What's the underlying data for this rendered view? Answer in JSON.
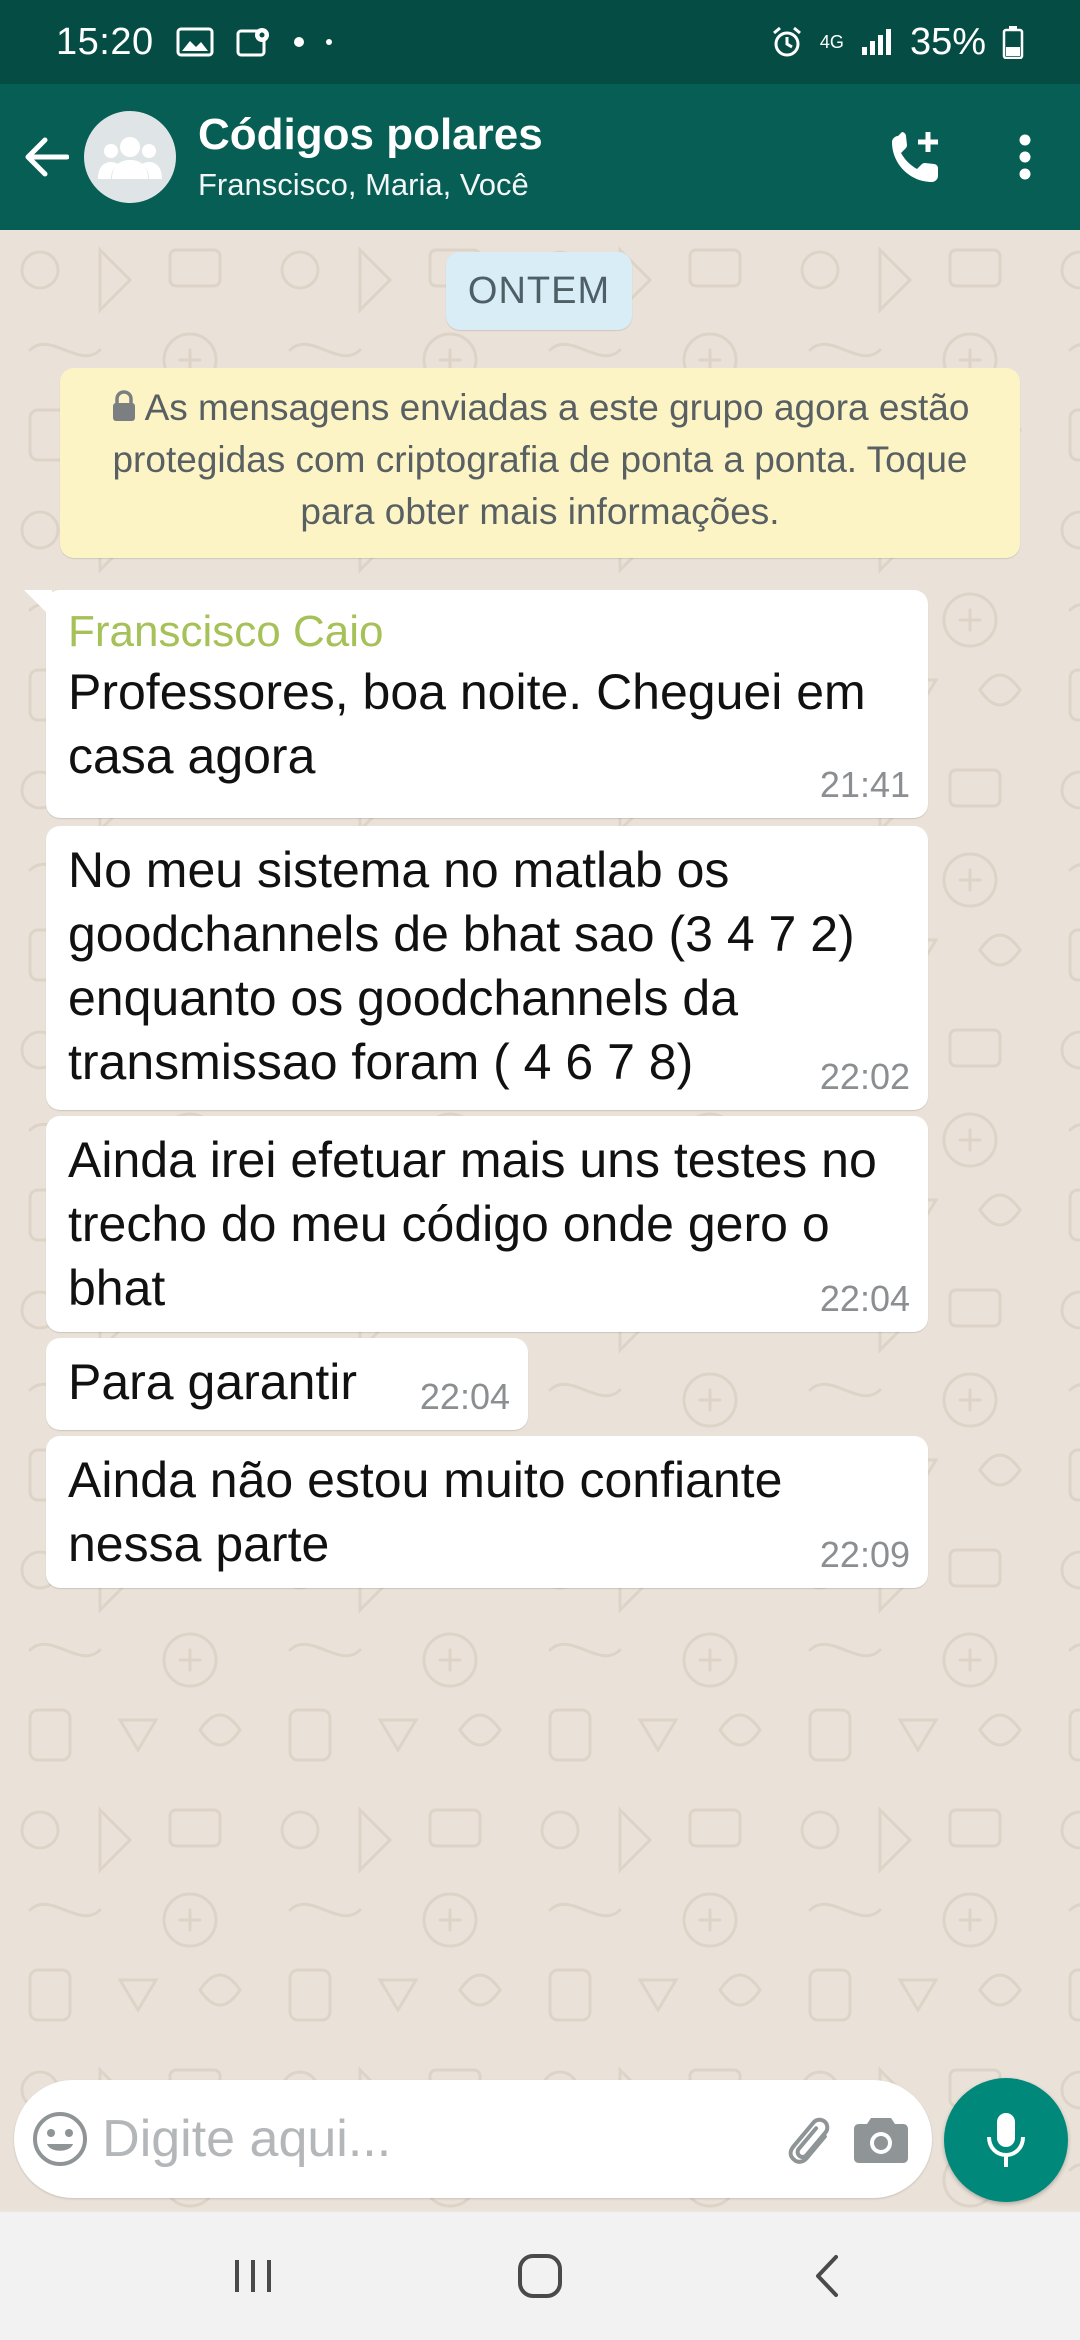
{
  "status_bar": {
    "time": "15:20",
    "network": "4G",
    "battery": "35%"
  },
  "header": {
    "title": "Códigos polares",
    "subtitle": "Franscisco, Maria, Você"
  },
  "chat": {
    "date_chip": "ONTEM",
    "encryption_notice": "As mensagens enviadas a este grupo agora estão protegidas com criptografia de ponta a ponta. Toque para obter mais informações.",
    "messages": [
      {
        "sender": "Franscisco Caio",
        "text": "Professores, boa noite. Cheguei em casa agora",
        "time": "21:41"
      },
      {
        "text": "No meu sistema no matlab os goodchannels de bhat sao (3 4 7 2) enquanto os goodchannels da transmissao foram ( 4 6 7 8)",
        "time": "22:02"
      },
      {
        "text": "Ainda irei efetuar mais uns testes no trecho do meu código onde gero o bhat",
        "time": "22:04"
      },
      {
        "text": "Para garantir",
        "time": "22:04"
      },
      {
        "text": "Ainda não estou muito confiante nessa parte",
        "time": "22:09"
      }
    ]
  },
  "composer": {
    "placeholder": "Digite aqui..."
  },
  "colors": {
    "status_bar": "#054D44",
    "header": "#075E54",
    "sender_name": "#A5C157",
    "mic_button": "#00897B",
    "encryption_bg": "#FDF4C5",
    "date_chip_bg": "#D9EDF6"
  },
  "icons": {
    "back": "arrow-left-icon",
    "avatar": "group-icon",
    "call": "add-call-icon",
    "menu": "more-vert-icon",
    "emoji": "emoji-icon",
    "attach": "paperclip-icon",
    "camera": "camera-icon",
    "mic": "mic-icon"
  }
}
